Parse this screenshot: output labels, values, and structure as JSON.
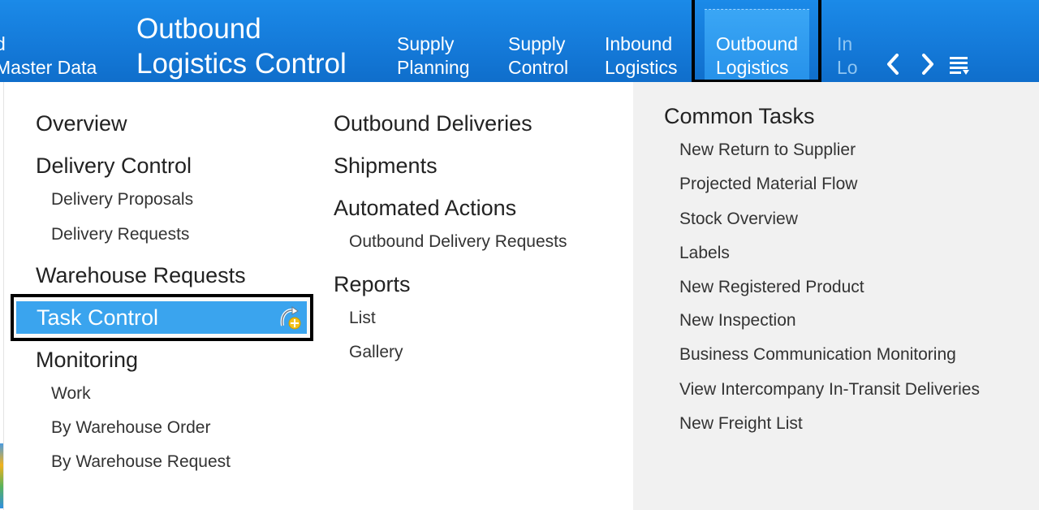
{
  "header": {
    "left_fragment": [
      "d",
      "Master Data"
    ],
    "title": [
      "Outbound",
      "Logistics Control"
    ],
    "tabs": [
      {
        "line1": "Supply",
        "line2": "Planning"
      },
      {
        "line1": "Supply",
        "line2": "Control"
      },
      {
        "line1": "Inbound",
        "line2": "Logistics"
      },
      {
        "line1": "Outbound",
        "line2": "Logistics"
      },
      {
        "line1": "In",
        "line2": "Lo"
      }
    ],
    "nav_icons": [
      "chevron-left-icon",
      "chevron-right-icon",
      "menu-list-icon"
    ]
  },
  "col1": {
    "overview": "Overview",
    "delivery_control": "Delivery Control",
    "delivery_proposals": "Delivery Proposals",
    "delivery_requests": "Delivery Requests",
    "warehouse_requests": "Warehouse Requests",
    "task_control": "Task Control",
    "task_control_icon": "add-favorite-icon",
    "monitoring": "Monitoring",
    "work": "Work",
    "by_warehouse_order": "By Warehouse Order",
    "by_warehouse_request": "By Warehouse Request"
  },
  "col2": {
    "outbound_deliveries": "Outbound Deliveries",
    "shipments": "Shipments",
    "automated_actions": "Automated Actions",
    "outbound_delivery_requests": "Outbound Delivery Requests",
    "reports": "Reports",
    "list": "List",
    "gallery": "Gallery"
  },
  "common_tasks": {
    "title": "Common Tasks",
    "items": [
      "New Return to Supplier",
      "Projected Material Flow",
      "Stock Overview",
      "Labels",
      "New Registered Product",
      "New Inspection",
      "Business Communication Monitoring",
      "View Intercompany In-Transit Deliveries",
      "New Freight List"
    ]
  },
  "colors": {
    "header_blue": "#1479d8",
    "active_tab": "#2792ea",
    "highlight_item": "#3aa4ee",
    "right_panel_bg": "#f1f1f1"
  }
}
